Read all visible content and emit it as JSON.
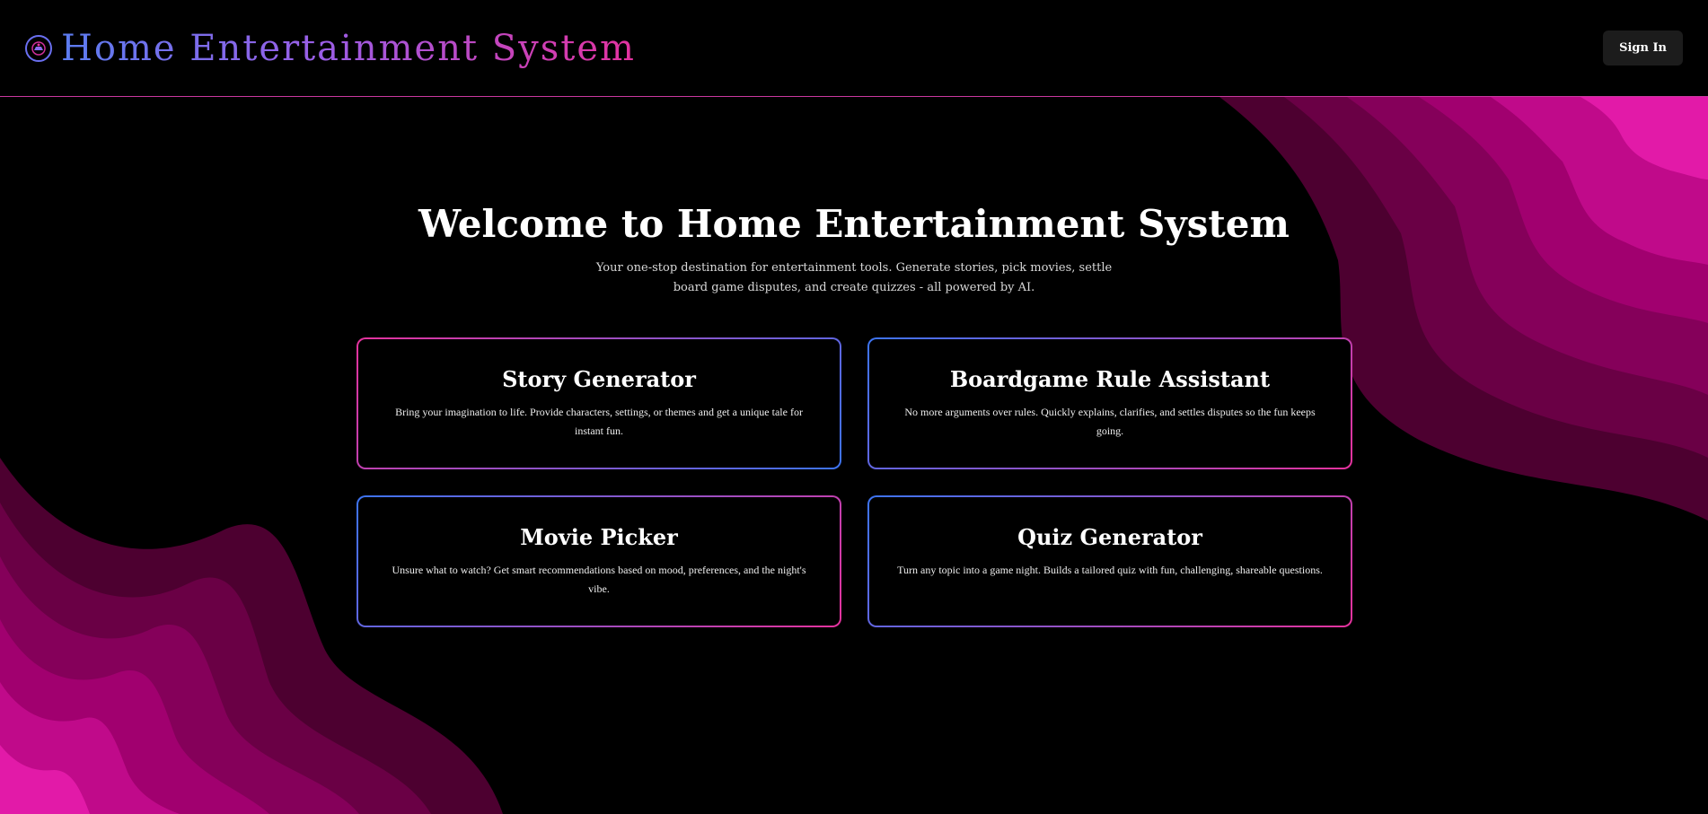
{
  "header": {
    "app_title": "Home Entertainment System",
    "signin_label": "Sign In"
  },
  "hero": {
    "title": "Welcome to Home Entertainment System",
    "subtitle": "Your one-stop destination for entertainment tools. Generate stories, pick movies, settle board game disputes, and create quizzes - all powered by AI."
  },
  "tools": [
    {
      "title": "Story Generator",
      "description": "Bring your imagination to life. Provide characters, settings, or themes and get a unique tale for instant fun."
    },
    {
      "title": "Boardgame Rule Assistant",
      "description": "No more arguments over rules. Quickly explains, clarifies, and settles disputes so the fun keeps going."
    },
    {
      "title": "Movie Picker",
      "description": "Unsure what to watch? Get smart recommendations based on mood, preferences, and the night's vibe."
    },
    {
      "title": "Quiz Generator",
      "description": "Turn any topic into a game night. Builds a tailored quiz with fun, challenging, shareable questions."
    }
  ],
  "colors": {
    "accent_blue": "#3c74f2",
    "accent_pink": "#e5329d",
    "wave_dark": "#5a0038",
    "wave_bright": "#e21aa8"
  },
  "icons": {
    "logo": "logo-icon"
  }
}
